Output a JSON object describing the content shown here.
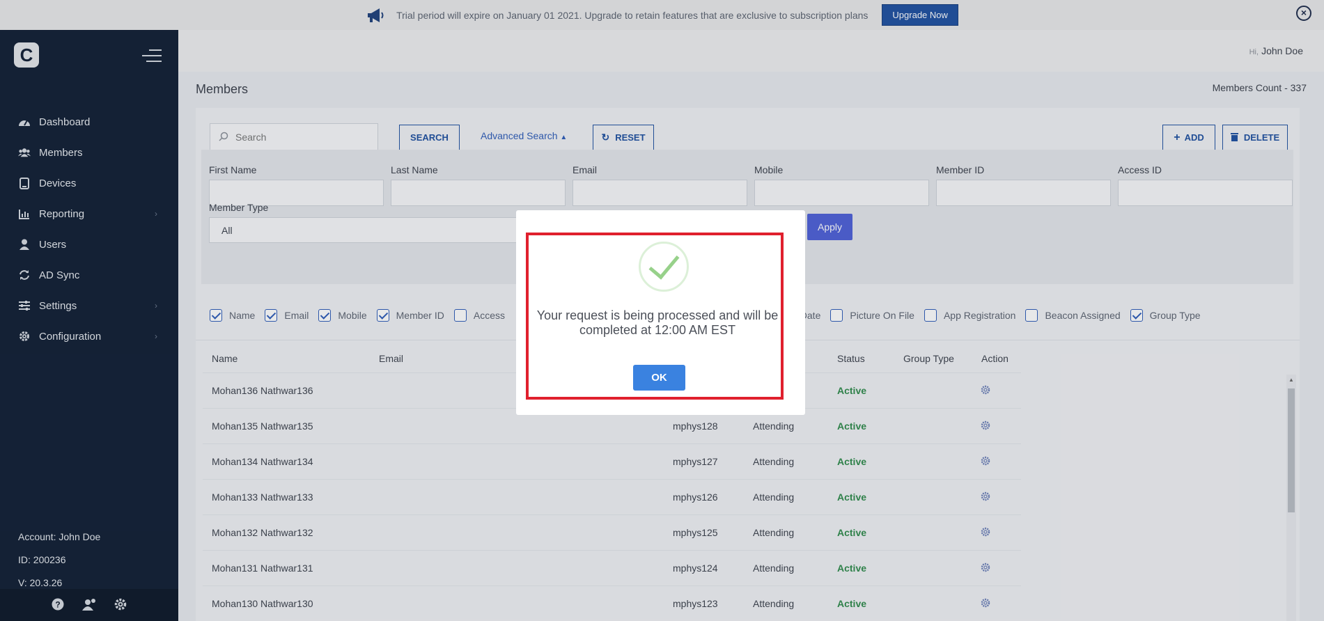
{
  "banner": {
    "message": "Trial period will expire on January 01 2021. Upgrade to retain features that are exclusive to subscription plans",
    "upgrade_label": "Upgrade Now",
    "close_icon": "close-circle-icon"
  },
  "sidebar": {
    "logo_letter": "C",
    "items": [
      {
        "label": "Dashboard",
        "icon": "dashboard-icon"
      },
      {
        "label": "Members",
        "icon": "members-icon"
      },
      {
        "label": "Devices",
        "icon": "tablet-icon"
      },
      {
        "label": "Reporting",
        "icon": "chart-icon",
        "chevron": "›"
      },
      {
        "label": "Users",
        "icon": "user-icon"
      },
      {
        "label": "AD Sync",
        "icon": "sync-icon"
      },
      {
        "label": "Settings",
        "icon": "sliders-icon",
        "chevron": "›"
      },
      {
        "label": "Configuration",
        "icon": "gear-icon",
        "chevron": "›"
      }
    ],
    "account": "Account: John Doe",
    "id": "ID: 200236",
    "version": "V: 20.3.26"
  },
  "header": {
    "hi": "Hi,",
    "user": "John Doe"
  },
  "page": {
    "title": "Members",
    "count": "Members Count - 337"
  },
  "toolbar": {
    "search_placeholder": "Search",
    "search_label": "SEARCH",
    "advanced_label": "Advanced Search",
    "reset_label": "RESET",
    "add_label": "ADD",
    "delete_label": "DELETE"
  },
  "filters": {
    "first_name": "First Name",
    "last_name": "Last Name",
    "email": "Email",
    "mobile": "Mobile",
    "member_id": "Member ID",
    "access_id": "Access ID",
    "member_type": "Member Type",
    "member_type_value": "All",
    "apply_label": "Apply"
  },
  "columns": [
    {
      "label": "Name",
      "checked": true
    },
    {
      "label": "Email",
      "checked": true
    },
    {
      "label": "Mobile",
      "checked": true
    },
    {
      "label": "Member ID",
      "checked": true
    },
    {
      "label": "Access",
      "checked": false
    },
    {
      "label": "stration Date",
      "checked": false
    },
    {
      "label": "Picture On File",
      "checked": false
    },
    {
      "label": "App Registration",
      "checked": false
    },
    {
      "label": "Beacon Assigned",
      "checked": false
    },
    {
      "label": "Group Type",
      "checked": true
    }
  ],
  "table": {
    "headers": [
      "Name",
      "Email",
      "Status",
      "Group Type",
      "Action"
    ],
    "rows": [
      {
        "name": "Mohan136 Nathwar136",
        "member_id": "",
        "type": "",
        "status": "Active"
      },
      {
        "name": "Mohan135 Nathwar135",
        "member_id": "mphys128",
        "type": "Attending",
        "status": "Active"
      },
      {
        "name": "Mohan134 Nathwar134",
        "member_id": "mphys127",
        "type": "Attending",
        "status": "Active"
      },
      {
        "name": "Mohan133 Nathwar133",
        "member_id": "mphys126",
        "type": "Attending",
        "status": "Active"
      },
      {
        "name": "Mohan132 Nathwar132",
        "member_id": "mphys125",
        "type": "Attending",
        "status": "Active"
      },
      {
        "name": "Mohan131 Nathwar131",
        "member_id": "mphys124",
        "type": "Attending",
        "status": "Active"
      },
      {
        "name": "Mohan130 Nathwar130",
        "member_id": "mphys123",
        "type": "Attending",
        "status": "Active"
      }
    ]
  },
  "modal": {
    "message": "Your request is being processed and will be completed at 12:00 AM EST",
    "ok_label": "OK"
  },
  "colors": {
    "sidebar": "#0f1d33",
    "accent": "#1d4fa0",
    "status_active": "#2e8a4a",
    "highlight_border": "#e0202e",
    "ok_button": "#3a82e0"
  }
}
